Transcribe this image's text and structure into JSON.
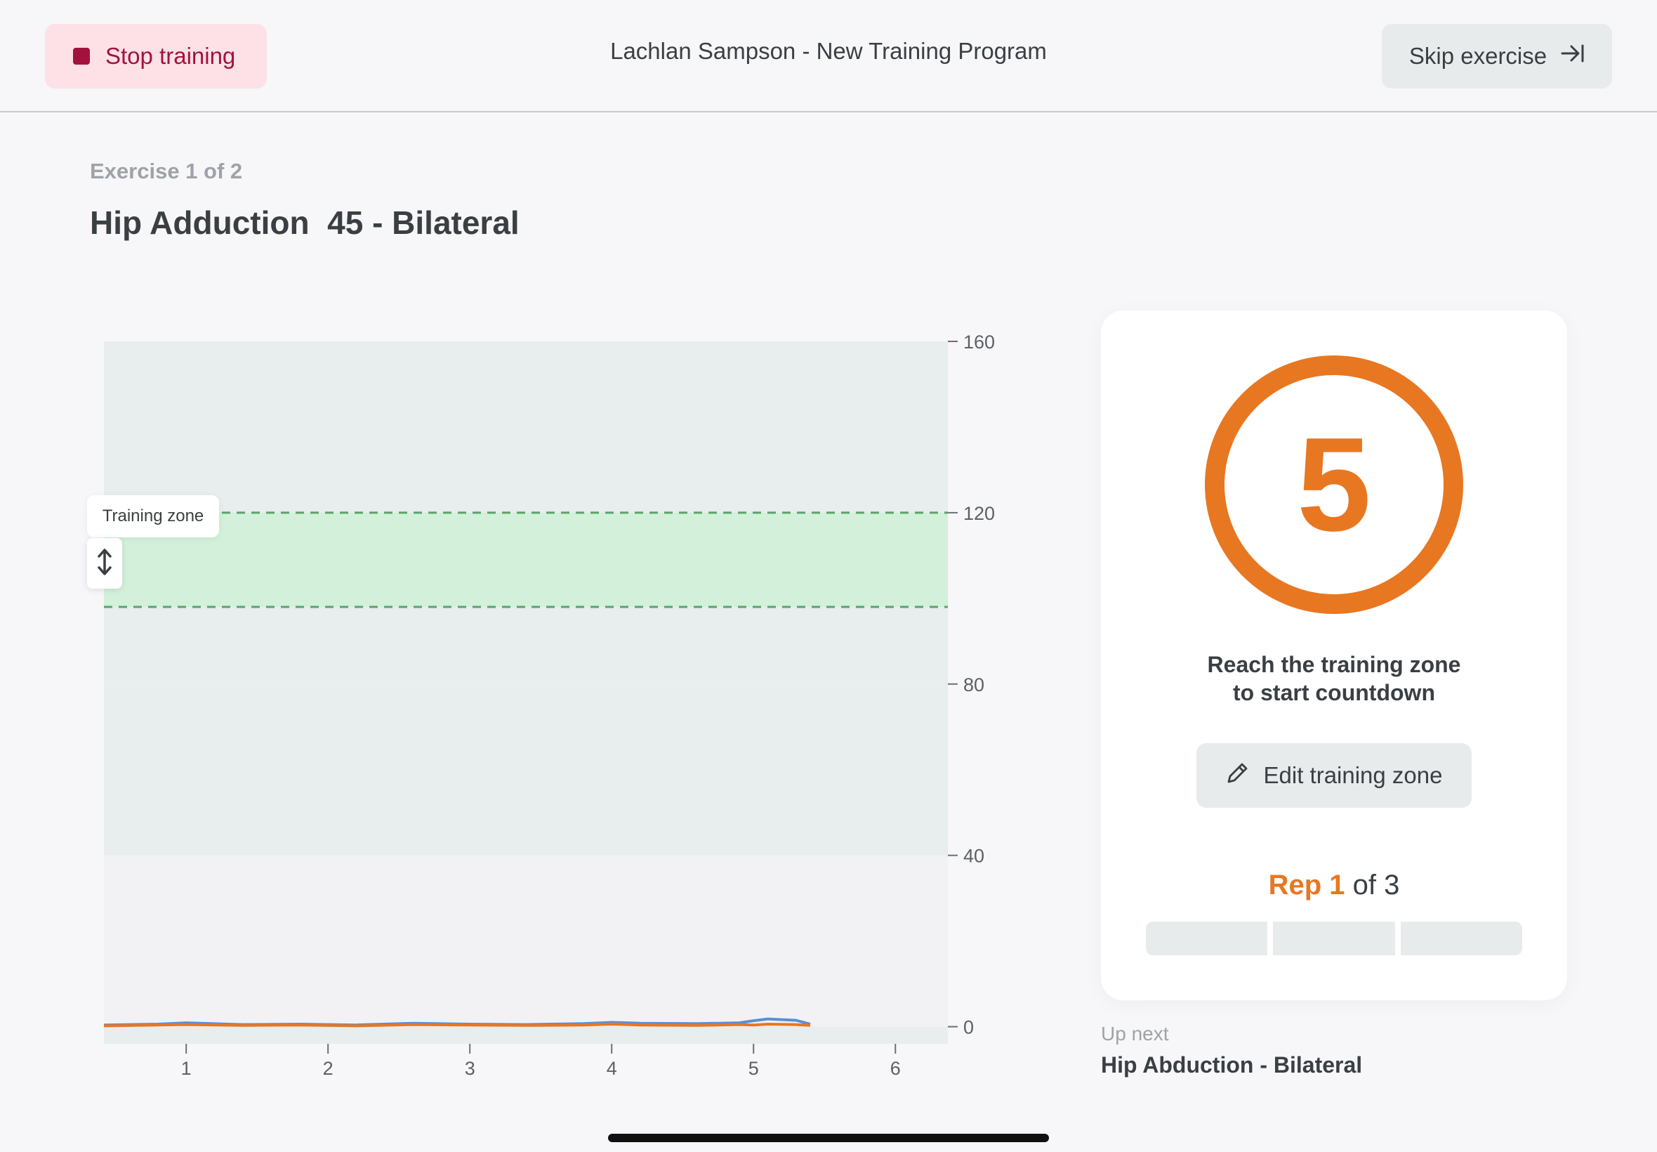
{
  "header": {
    "stop_label": "Stop training",
    "title": "Lachlan Sampson - New Training Program",
    "skip_label": "Skip exercise"
  },
  "exercise": {
    "counter": "Exercise 1 of 2",
    "title": "Hip Adduction  45 - Bilateral"
  },
  "chart_data": {
    "type": "line",
    "title": "",
    "xlabel": "",
    "ylabel": "",
    "xlim": [
      0.42,
      6.37
    ],
    "ylim": [
      -4,
      160
    ],
    "x_ticks": [
      1,
      2,
      3,
      4,
      5,
      6
    ],
    "y_ticks": [
      0,
      40,
      80,
      120,
      160
    ],
    "bands": [
      {
        "from": 80,
        "to": 160,
        "color": "#e8edee"
      },
      {
        "from": 98,
        "to": 120,
        "color": "#d3f0da",
        "label": "Training zone"
      },
      {
        "from": 0,
        "to": 40,
        "color": "#f2f2f5"
      },
      {
        "from": 40,
        "to": 80,
        "color": "#e8edee"
      },
      {
        "from": -4,
        "to": 0,
        "color": "#e8edee"
      }
    ],
    "zone": {
      "lower": 98,
      "upper": 120,
      "line_color": "#5aa36b"
    },
    "series": [
      {
        "color": "#5b8ed6",
        "x": [
          0.42,
          0.8,
          1.0,
          1.4,
          1.8,
          2.2,
          2.6,
          3.0,
          3.4,
          3.8,
          4.0,
          4.2,
          4.6,
          4.9,
          5.0,
          5.1,
          5.3,
          5.4
        ],
        "y": [
          0.4,
          0.6,
          0.9,
          0.5,
          0.6,
          0.4,
          0.8,
          0.6,
          0.5,
          0.7,
          1.0,
          0.8,
          0.7,
          0.9,
          1.4,
          1.8,
          1.5,
          0.6
        ]
      },
      {
        "color": "#e87722",
        "x": [
          0.42,
          0.8,
          1.0,
          1.4,
          1.8,
          2.2,
          2.6,
          3.0,
          3.4,
          3.8,
          4.0,
          4.2,
          4.6,
          4.9,
          5.0,
          5.1,
          5.3,
          5.4
        ],
        "y": [
          0.2,
          0.4,
          0.5,
          0.3,
          0.4,
          0.2,
          0.5,
          0.4,
          0.3,
          0.4,
          0.6,
          0.4,
          0.3,
          0.5,
          0.4,
          0.6,
          0.5,
          0.3
        ]
      }
    ]
  },
  "zone_label": "Training zone",
  "card": {
    "countdown": "5",
    "hint_line1": "Reach the training zone",
    "hint_line2": "to start countdown",
    "edit_label": "Edit training zone",
    "rep_word": "Rep",
    "rep_current": "1",
    "rep_of": "of 3",
    "rep_total": 3,
    "reps_completed": 0,
    "accent": "#e87722"
  },
  "up_next": {
    "label": "Up next",
    "name": "Hip Abduction - Bilateral"
  }
}
